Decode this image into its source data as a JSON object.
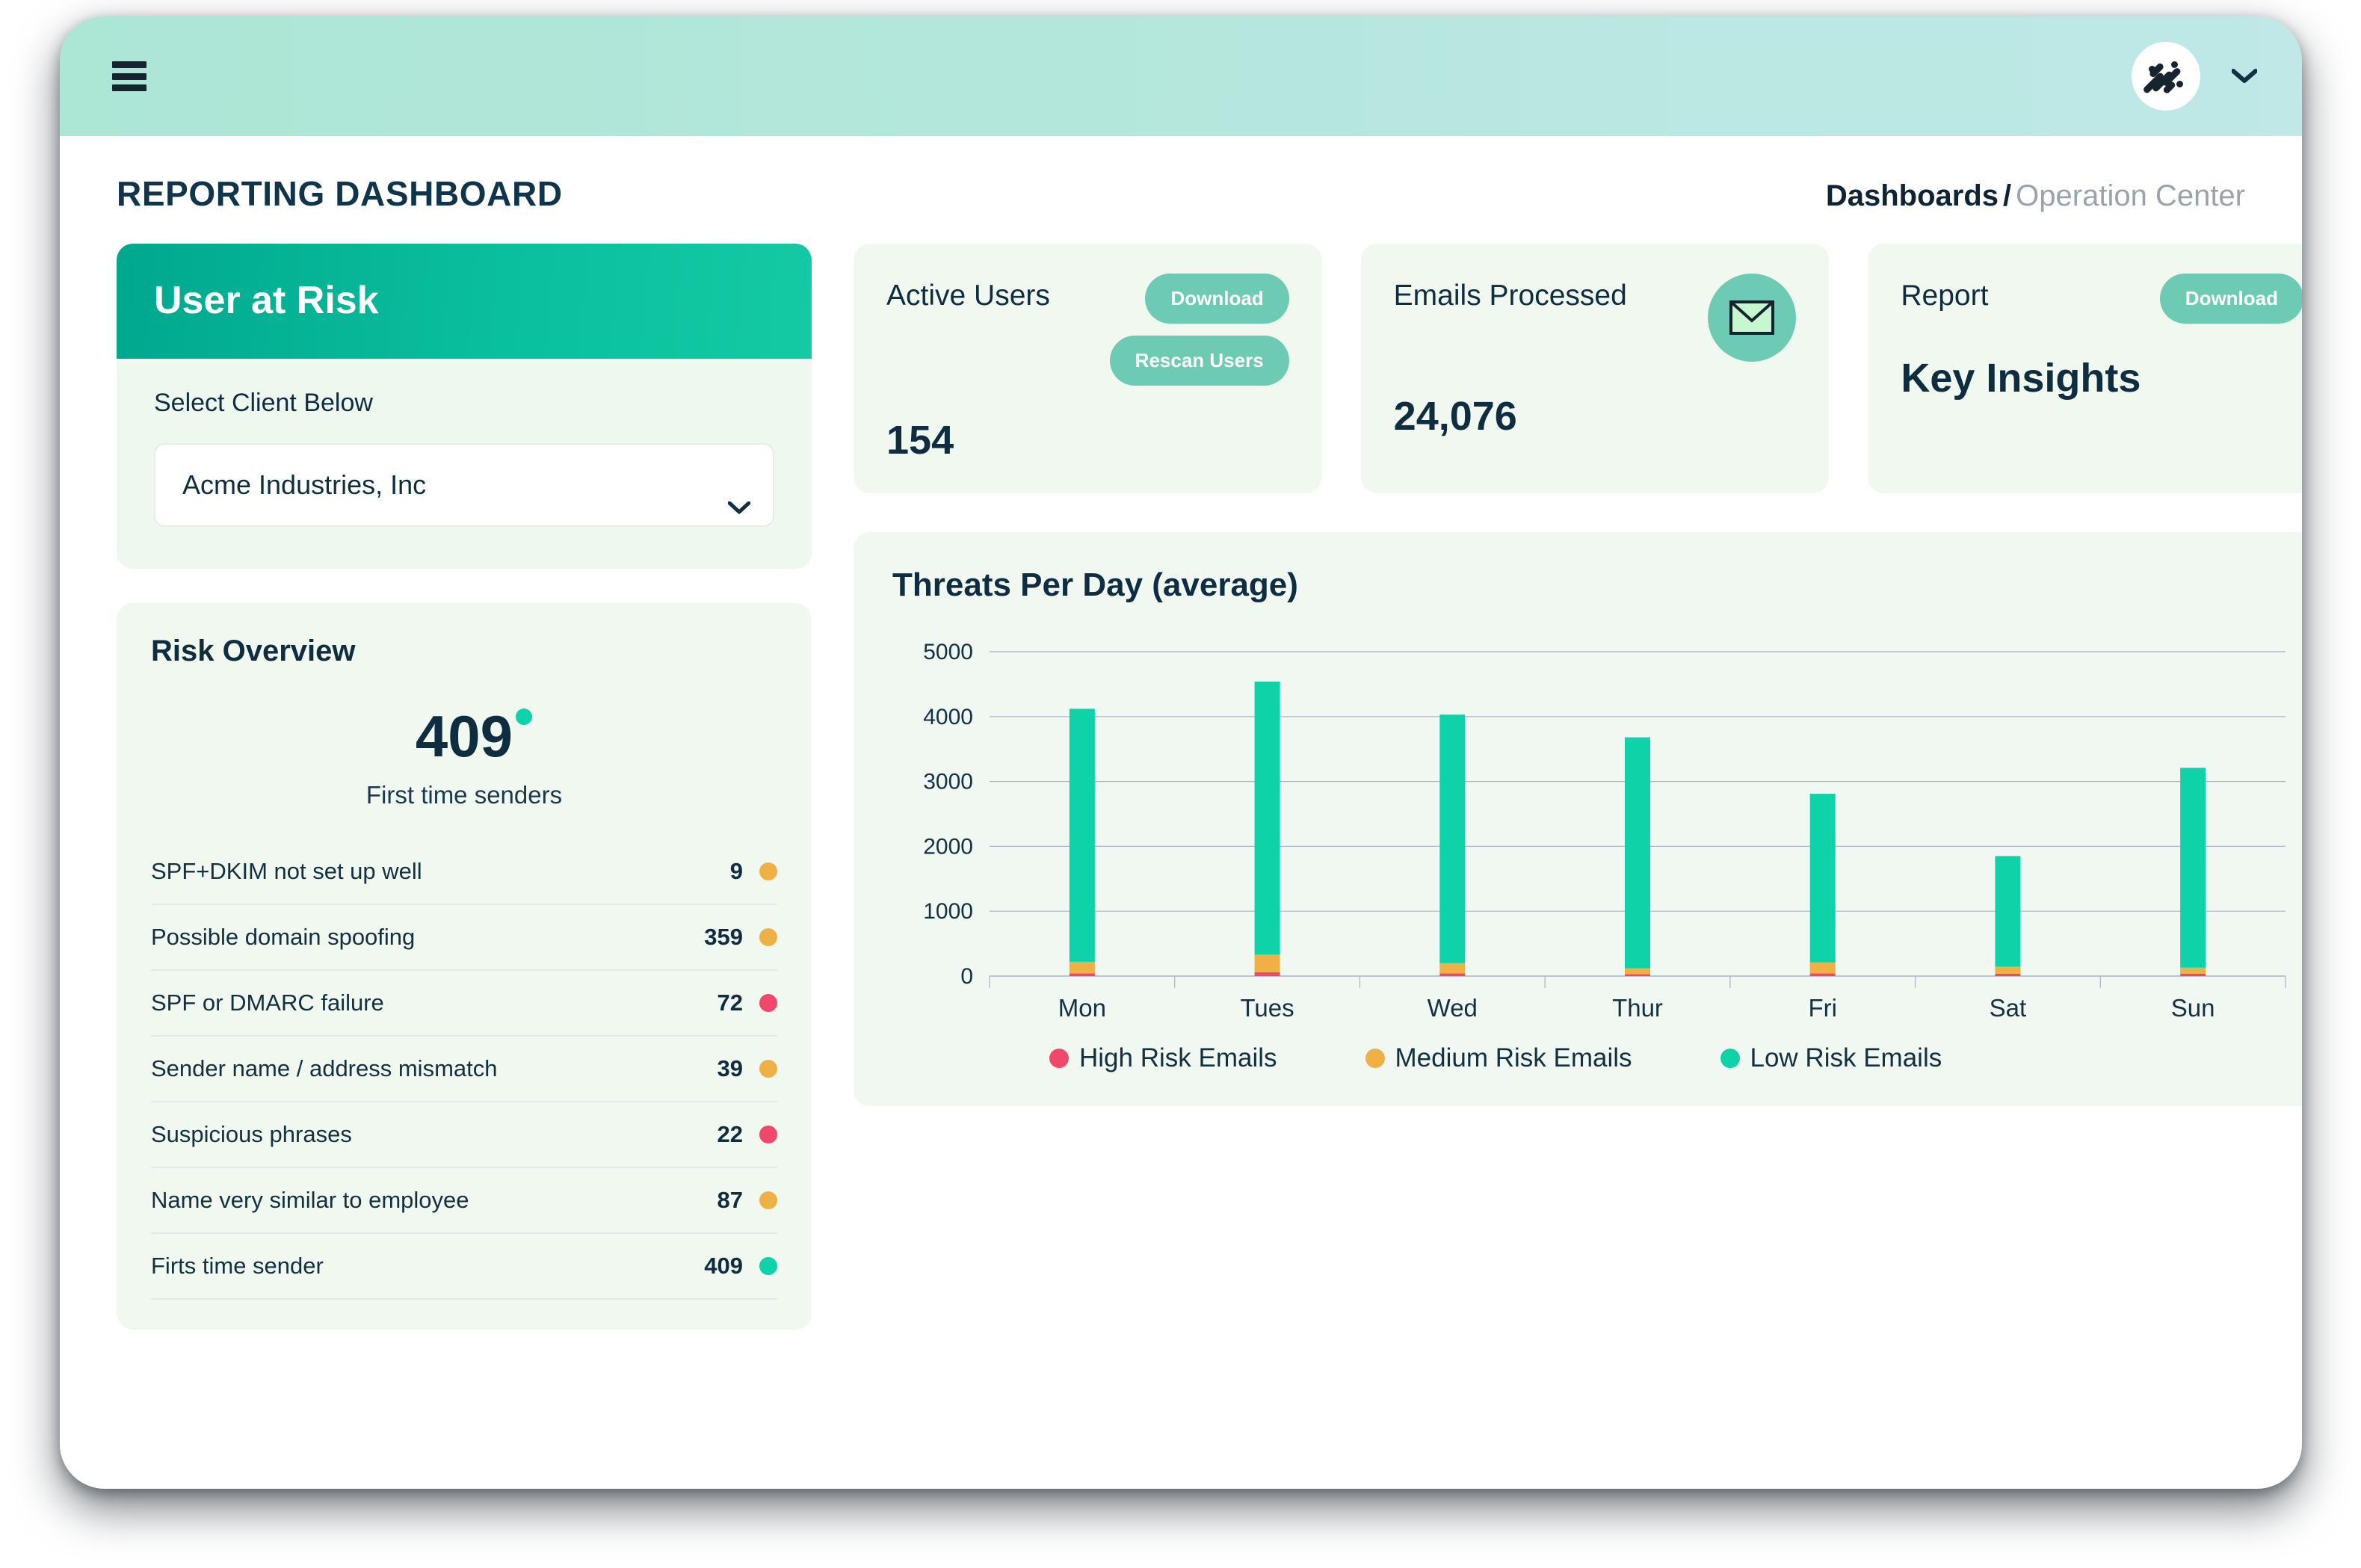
{
  "header": {
    "menu_icon": "hamburger-icon",
    "avatar_icon": "logo-avatar-icon",
    "caret_icon": "chevron-down-icon"
  },
  "page": {
    "title": "REPORTING DASHBOARD",
    "breadcrumb": {
      "root": "Dashboards",
      "separator": "/",
      "current": "Operation Center"
    }
  },
  "user_at_risk": {
    "heading": "User at Risk",
    "select_label": "Select Client Below",
    "selected_client": "Acme Industries, Inc",
    "caret_icon": "chevron-down-icon"
  },
  "risk_overview": {
    "heading": "Risk Overview",
    "highlight_value": "409",
    "highlight_label": "First time senders",
    "highlight_dot_color": "#0ed2a8",
    "rows": [
      {
        "label": "SPF+DKIM not set up well",
        "value": "9",
        "color": "#efb045"
      },
      {
        "label": "Possible domain spoofing",
        "value": "359",
        "color": "#efb045"
      },
      {
        "label": "SPF or DMARC failure",
        "value": "72",
        "color": "#f0486a"
      },
      {
        "label": "Sender name / address mismatch",
        "value": "39",
        "color": "#efb045"
      },
      {
        "label": "Suspicious phrases",
        "value": "22",
        "color": "#f0486a"
      },
      {
        "label": "Name very similar to employee",
        "value": "87",
        "color": "#efb045"
      },
      {
        "label": "Firts time sender",
        "value": "409",
        "color": "#0ed2a8"
      }
    ]
  },
  "stat_cards": [
    {
      "label": "Active Users",
      "value": "154",
      "buttons": [
        "Download",
        "Rescan Users"
      ],
      "icon": null
    },
    {
      "label": "Emails Processed",
      "value": "24,076",
      "buttons": [],
      "icon": "envelope-icon"
    },
    {
      "label": "Report",
      "value": "Key Insights",
      "buttons": [
        "Download"
      ],
      "icon": null
    }
  ],
  "chart_data": {
    "type": "bar",
    "title": "Threats Per Day (average)",
    "xlabel": "",
    "ylabel": "",
    "ylim": [
      0,
      5000
    ],
    "yticks": [
      0,
      1000,
      2000,
      3000,
      4000,
      5000
    ],
    "grid": true,
    "stacked": true,
    "legend_position": "bottom",
    "categories": [
      "Mon",
      "Tues",
      "Wed",
      "Thur",
      "Fri",
      "Sat",
      "Sun"
    ],
    "series": [
      {
        "name": "High Risk Emails",
        "color": "#f0486a",
        "values": [
          40,
          60,
          40,
          30,
          40,
          35,
          35
        ]
      },
      {
        "name": "Medium Risk Emails",
        "color": "#efb045",
        "values": [
          180,
          270,
          160,
          90,
          170,
          110,
          95
        ]
      },
      {
        "name": "Low Risk Emails",
        "color": "#0ed2a8",
        "values": [
          3900,
          4210,
          3830,
          3560,
          2600,
          1705,
          3080
        ]
      }
    ],
    "totals": [
      4120,
      4540,
      4030,
      3680,
      2810,
      1850,
      3210
    ]
  },
  "colors": {
    "brand_teal": "#0ed2a8",
    "brand_teal_dark": "#00a88e",
    "header_gradient_start": "#ace6d5",
    "header_gradient_end": "#bfe8e7",
    "ink": "#0e2d40",
    "card_bg": "#f0f8f0",
    "pill": "#6dcbb4",
    "amber": "#efb045",
    "red": "#f0486a"
  }
}
